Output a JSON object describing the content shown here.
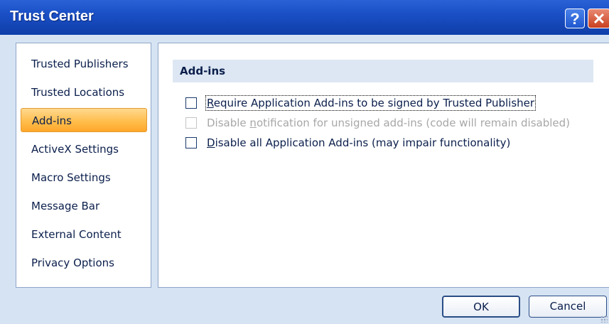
{
  "window": {
    "title": "Trust Center",
    "help_glyph": "?",
    "close_glyph": "✕"
  },
  "sidebar": {
    "items": [
      {
        "label": "Trusted Publishers"
      },
      {
        "label": "Trusted Locations"
      },
      {
        "label": "Add-ins",
        "selected": true
      },
      {
        "label": "ActiveX Settings"
      },
      {
        "label": "Macro Settings"
      },
      {
        "label": "Message Bar"
      },
      {
        "label": "External Content"
      },
      {
        "label": "Privacy Options"
      }
    ]
  },
  "content": {
    "section_title": "Add-ins",
    "options": [
      {
        "mnemonic": "R",
        "rest": "equire Application Add-ins to be signed by Trusted Publisher",
        "checked": false,
        "enabled": true
      },
      {
        "before": "Disable ",
        "mnemonic": "n",
        "rest": "otification for unsigned add-ins (code will remain disabled)",
        "checked": false,
        "enabled": false
      },
      {
        "mnemonic": "D",
        "rest": "isable all Application Add-ins (may impair functionality)",
        "checked": false,
        "enabled": true
      }
    ]
  },
  "buttons": {
    "ok": "OK",
    "cancel": "Cancel"
  },
  "colors": {
    "titlebar": "#1a4fc6",
    "selected_nav": "#ffbe4d",
    "section_header_bg": "#dde7f3",
    "text": "#0b1f4c"
  }
}
